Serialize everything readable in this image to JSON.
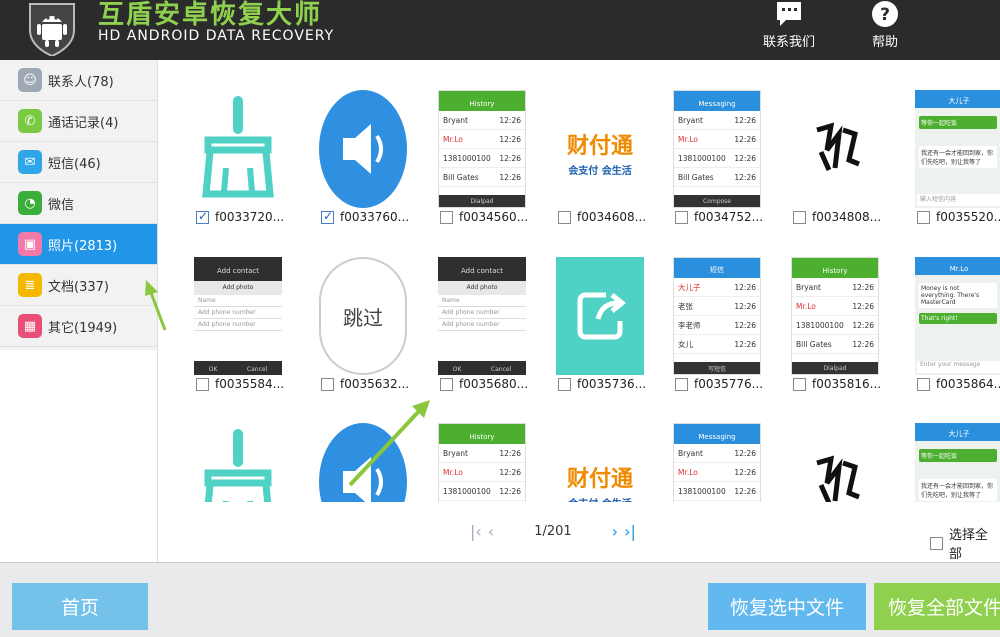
{
  "header": {
    "title_cn": "互盾安卓恢复大师",
    "title_en": "HD ANDROID DATA RECOVERY",
    "contact_label": "联系我们",
    "help_label": "帮助"
  },
  "sidebar": {
    "items": [
      {
        "label": "联系人(78)",
        "icon": "contacts-icon",
        "color": "#9ea7b4"
      },
      {
        "label": "通话记录(4)",
        "icon": "call-log-icon",
        "color": "#7ac943"
      },
      {
        "label": "短信(46)",
        "icon": "sms-icon",
        "color": "#2ea6e8"
      },
      {
        "label": "微信",
        "icon": "wechat-icon",
        "color": "#3aad3a"
      },
      {
        "label": "照片(2813)",
        "icon": "photo-icon",
        "color": "#f27aa8"
      },
      {
        "label": "文档(337)",
        "icon": "document-icon",
        "color": "#f5b800"
      },
      {
        "label": "其它(1949)",
        "icon": "other-icon",
        "color": "#e94e77"
      }
    ],
    "active_index": 4
  },
  "gallery": {
    "rows": [
      [
        {
          "name": "f0033720...",
          "checked": true,
          "kind": "broom"
        },
        {
          "name": "f0033760...",
          "checked": true,
          "kind": "speaker"
        },
        {
          "name": "f0034560...",
          "checked": false,
          "kind": "history"
        },
        {
          "name": "f0034608...",
          "checked": false,
          "kind": "caifutong"
        },
        {
          "name": "f0034752...",
          "checked": false,
          "kind": "messaging"
        },
        {
          "name": "f0034808...",
          "checked": false,
          "kind": "calligraphy"
        },
        {
          "name": "f0035520...",
          "checked": false,
          "kind": "chat"
        }
      ],
      [
        {
          "name": "f0035584...",
          "checked": false,
          "kind": "addcontact"
        },
        {
          "name": "f0035632...",
          "checked": false,
          "kind": "skip"
        },
        {
          "name": "f0035680...",
          "checked": false,
          "kind": "addcontact"
        },
        {
          "name": "f0035736...",
          "checked": false,
          "kind": "share"
        },
        {
          "name": "f0035776...",
          "checked": false,
          "kind": "sms_list"
        },
        {
          "name": "f0035816...",
          "checked": false,
          "kind": "history"
        },
        {
          "name": "f0035864...",
          "checked": false,
          "kind": "chat_en"
        }
      ],
      [
        {
          "kind": "broom"
        },
        {
          "kind": "speaker"
        },
        {
          "kind": "history"
        },
        {
          "kind": "caifutong"
        },
        {
          "kind": "messaging"
        },
        {
          "kind": "calligraphy"
        },
        {
          "kind": "chat"
        }
      ]
    ],
    "phone_text": {
      "history_title": "History",
      "history_rows": [
        "Bryant",
        "Mr.Lo",
        "1381000100",
        "Bill Gates"
      ],
      "history_foot": "Dialpad",
      "messaging_title": "Messaging",
      "messaging_rows": [
        "Bryant",
        "Mr.Lo",
        "1381000100",
        "Bill Gates"
      ],
      "messaging_foot": "Compose",
      "addcontact_title": "Add contact",
      "addcontact_photo": "Add photo",
      "addcontact_fields": [
        "Name",
        "Add phone number",
        "Add phone number"
      ],
      "addcontact_ok": "OK",
      "addcontact_cancel": "Cancel",
      "sms_title": "短信",
      "sms_rows": [
        "大儿子",
        "老张",
        "李老师",
        "女儿"
      ],
      "sms_foot": "写短信",
      "chat_title": "大儿子",
      "chat_msg1": "等你一起吃饭",
      "chat_msg2": "我还有一会才能回到家，你们先吃吧，别让我等了",
      "chat_input": "输入短信内容",
      "chat_en_title": "Mr.Lo",
      "chat_en_msg1": "Money is not everything. There's MasterCard",
      "chat_en_msg2": "That's right!",
      "chat_en_input": "Enter your message",
      "skip_text": "跳过",
      "caifu_brand": "财付通",
      "caifu_slogan": "会支付 会生活",
      "time": "12:26"
    }
  },
  "pager": {
    "page_text": "1/201"
  },
  "select_all_label": "选择全部",
  "footer": {
    "home_label": "首页",
    "recover_selected_label": "恢复选中文件",
    "recover_all_label": "恢复全部文件"
  },
  "colors": {
    "header_bg": "#2b2b2b",
    "accent_blue": "#2196e8",
    "accent_green": "#8fd14f",
    "home_btn": "#74c1ea",
    "recover_selected_btn": "#62b9f0",
    "recover_all_btn": "#8fd14f"
  }
}
